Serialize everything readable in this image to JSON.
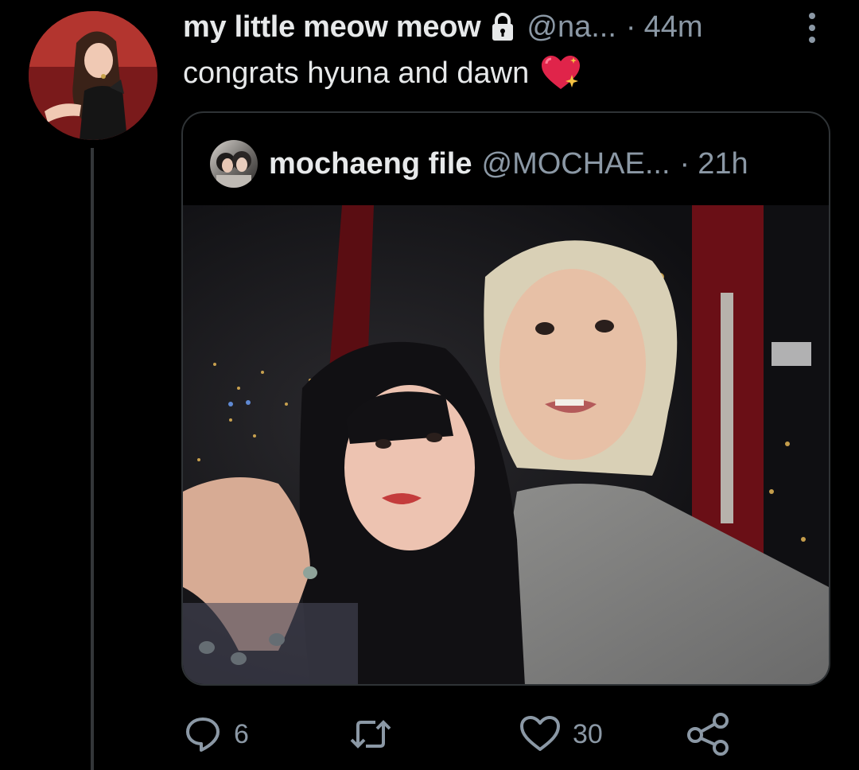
{
  "tweet": {
    "display_name": "my little meow meow",
    "handle": "@na...",
    "separator": "·",
    "time": "44m",
    "text": "congrats hyuna and dawn",
    "protected": true
  },
  "quote": {
    "display_name": "mochaeng file",
    "handle": "@MOCHAE...",
    "separator": "·",
    "time": "21h"
  },
  "actions": {
    "reply_count": "6",
    "retweet_count": "",
    "like_count": "30"
  },
  "icons": {
    "lock": "lock-icon",
    "more": "more-vertical-icon",
    "emoji": "sparkling-heart-icon",
    "reply": "reply-icon",
    "retweet": "retweet-icon",
    "like": "heart-icon",
    "share": "share-icon"
  },
  "colors": {
    "background": "#000000",
    "text_primary": "#e7e9ea",
    "text_secondary": "#8b98a5",
    "border": "#2f3336",
    "thread_line": "#333639"
  }
}
